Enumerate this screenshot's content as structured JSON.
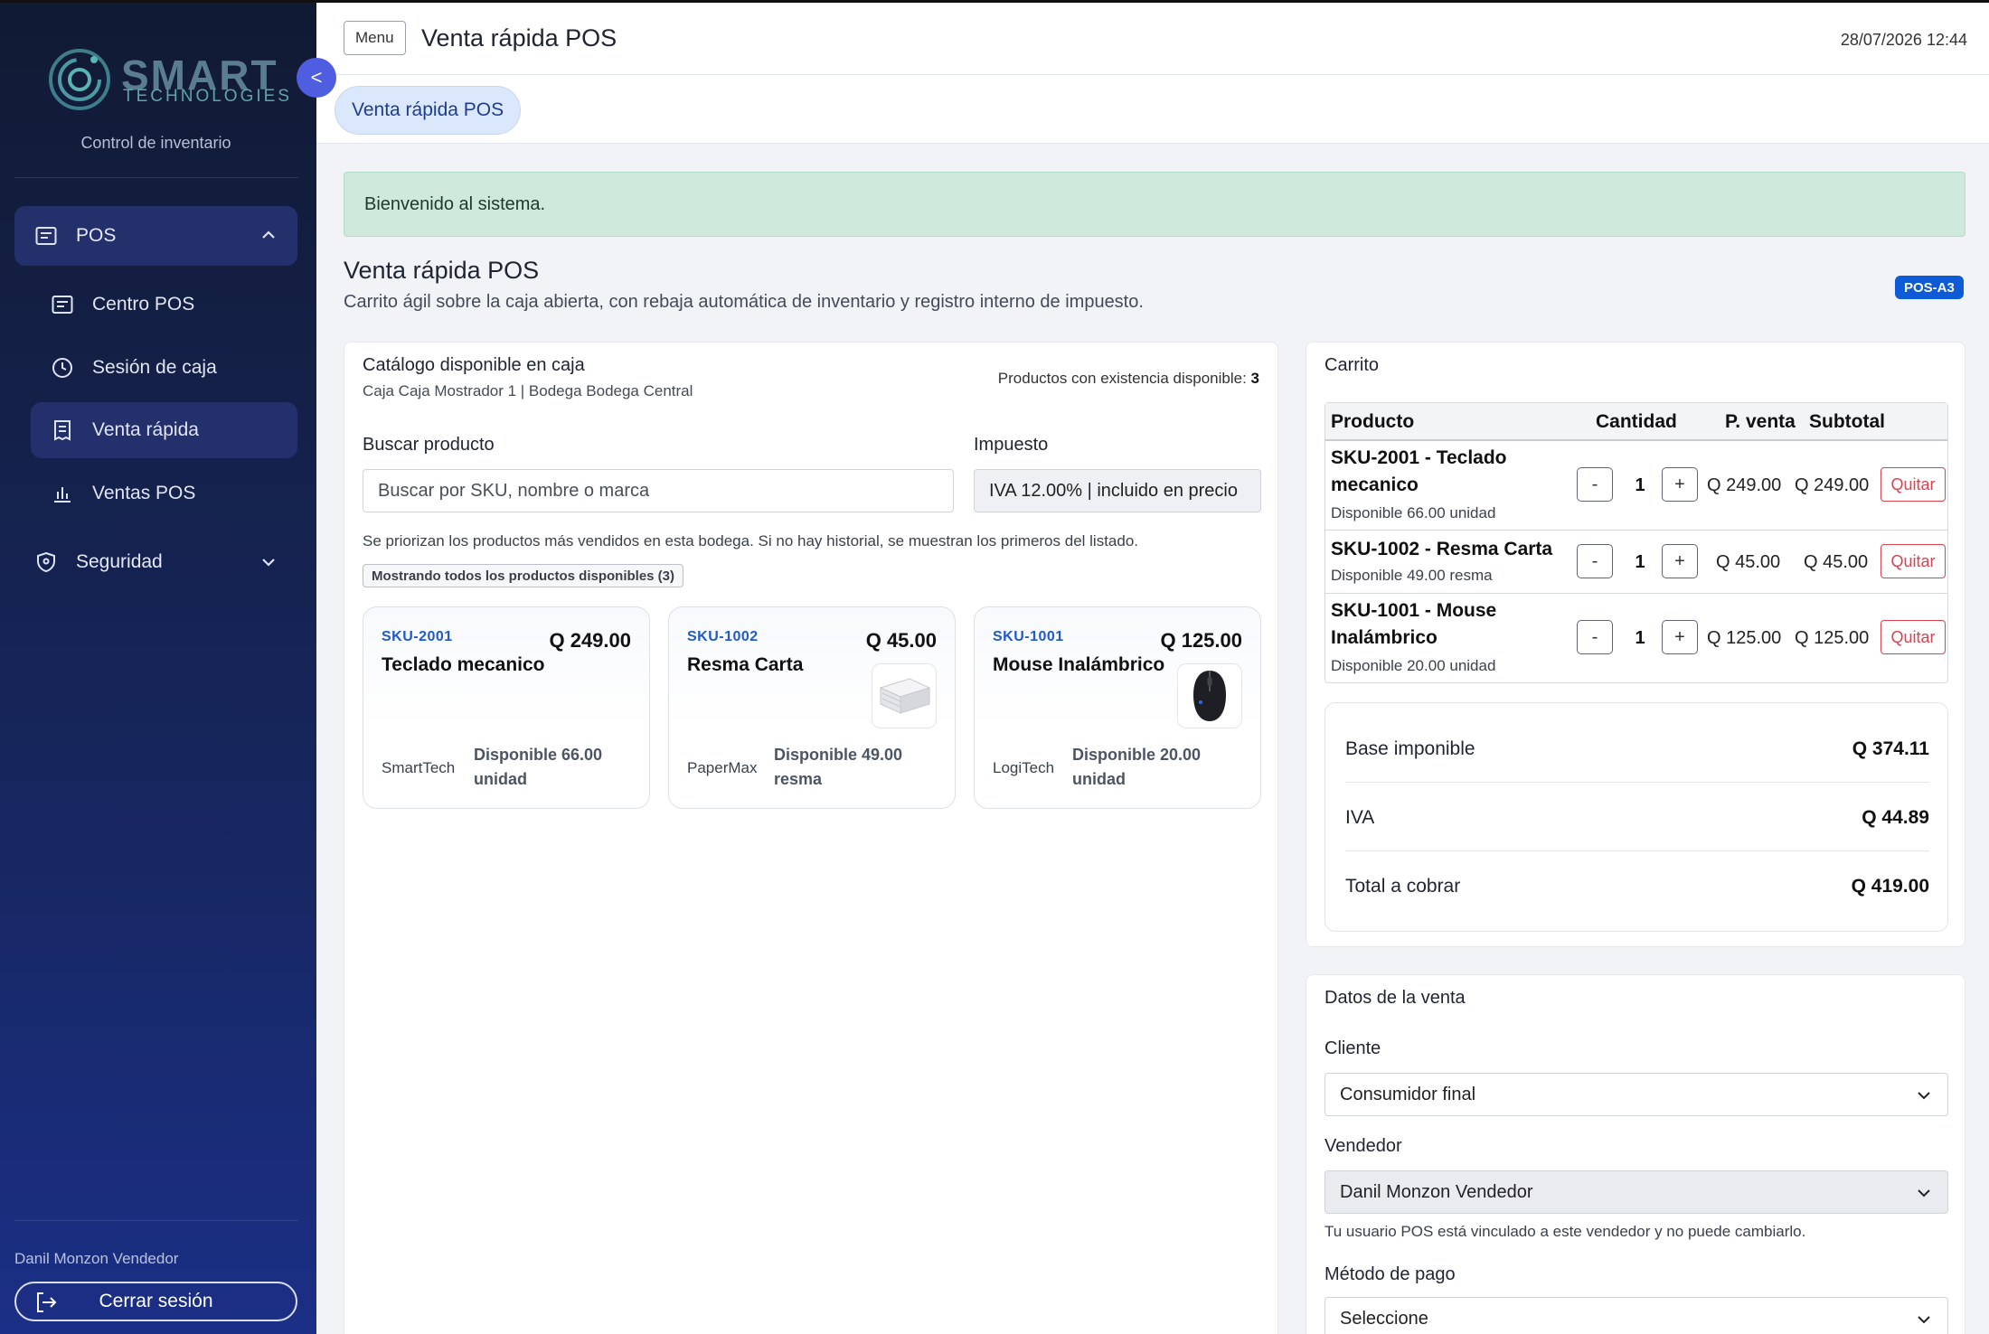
{
  "sidebar": {
    "logo_main": "SMART",
    "logo_sub": "TECHNOLOGIES",
    "subtitle": "Control de inventario",
    "collapse_label": "<",
    "pos_group": "POS",
    "items": [
      {
        "label": "Centro POS",
        "icon": "receipt-icon"
      },
      {
        "label": "Sesión de caja",
        "icon": "clock-icon"
      },
      {
        "label": "Venta rápida",
        "icon": "invoice-icon"
      },
      {
        "label": "Ventas POS",
        "icon": "bar-chart-icon"
      }
    ],
    "security_group": "Seguridad",
    "user_name": "Danil Monzon Vendedor",
    "logout_label": "Cerrar sesión"
  },
  "header": {
    "menu_label": "Menu",
    "title": "Venta rápida POS",
    "datetime": "28/07/2026 12:44"
  },
  "tabs": [
    {
      "label": "Venta rápida POS"
    }
  ],
  "alert": "Bienvenido al sistema.",
  "page": {
    "title": "Venta rápida POS",
    "description": "Carrito ágil sobre la caja abierta, con rebaja automática de inventario y registro interno de impuesto.",
    "badge": "POS-A3"
  },
  "catalog": {
    "title": "Catálogo disponible en caja",
    "subtitle": "Caja Caja Mostrador 1 | Bodega Bodega Central",
    "count_label": "Productos con existencia disponible:",
    "count_value": "3",
    "search_label": "Buscar producto",
    "search_placeholder": "Buscar por SKU, nombre o marca",
    "tax_label": "Impuesto",
    "tax_value": "IVA 12.00% | incluido en precio",
    "hint": "Se priorizan los productos más vendidos en esta bodega. Si no hay historial, se muestran los primeros del listado.",
    "chip": "Mostrando todos los productos disponibles (3)",
    "products": [
      {
        "sku": "SKU-2001",
        "price": "Q 249.00",
        "name": "Teclado mecanico",
        "brand": "SmartTech",
        "available": "Disponible 66.00 unidad"
      },
      {
        "sku": "SKU-1002",
        "price": "Q 45.00",
        "name": "Resma Carta",
        "brand": "PaperMax",
        "available": "Disponible 49.00 resma"
      },
      {
        "sku": "SKU-1001",
        "price": "Q 125.00",
        "name": "Mouse Inalámbrico",
        "brand": "LogiTech",
        "available": "Disponible 20.00 unidad"
      }
    ]
  },
  "cart": {
    "title": "Carrito",
    "headers": {
      "product": "Producto",
      "qty": "Cantidad",
      "price": "P. venta",
      "subtotal": "Subtotal"
    },
    "minus": "-",
    "plus": "+",
    "remove": "Quitar",
    "rows": [
      {
        "name": "SKU-2001 - Teclado mecanico",
        "available": "Disponible 66.00 unidad",
        "qty": "1",
        "price": "Q 249.00",
        "subtotal": "Q 249.00"
      },
      {
        "name": "SKU-1002 - Resma Carta",
        "available": "Disponible 49.00 resma",
        "qty": "1",
        "price": "Q 45.00",
        "subtotal": "Q 45.00"
      },
      {
        "name": "SKU-1001 - Mouse Inalámbrico",
        "available": "Disponible 20.00 unidad",
        "qty": "1",
        "price": "Q 125.00",
        "subtotal": "Q 125.00"
      }
    ],
    "totals": [
      {
        "label": "Base imponible",
        "value": "Q 374.11"
      },
      {
        "label": "IVA",
        "value": "Q 44.89"
      },
      {
        "label": "Total a cobrar",
        "value": "Q 419.00"
      }
    ]
  },
  "sale": {
    "title": "Datos de la venta",
    "client_label": "Cliente",
    "client_value": "Consumidor final",
    "seller_label": "Vendedor",
    "seller_value": "Danil Monzon Vendedor",
    "seller_hint": "Tu usuario POS está vinculado a este vendedor y no puede cambiarlo.",
    "payment_label": "Método de pago",
    "payment_value": "Seleccione"
  },
  "colors": {
    "accent": "#4f5de0",
    "badge": "#0d5bd7",
    "danger": "#d9434f",
    "sku": "#1f5ac8"
  }
}
